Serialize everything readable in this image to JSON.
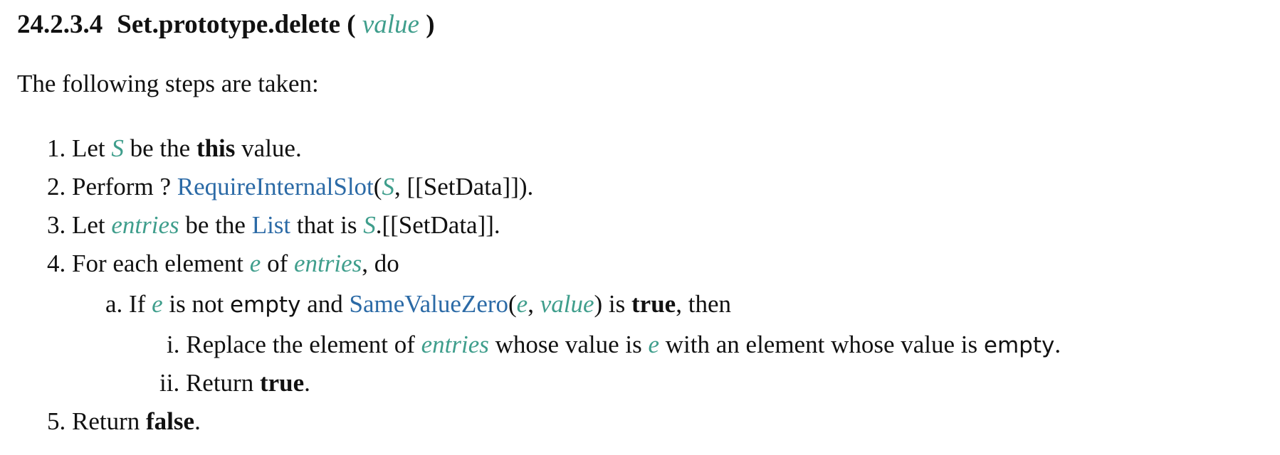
{
  "heading": {
    "number": "24.2.3.4",
    "name": "Set.prototype.delete (",
    "param": "value",
    "close": ")"
  },
  "intro": "The following steps are taken:",
  "steps": {
    "s1": {
      "marker": "1.",
      "t1": "Let",
      "v1": "S",
      "t2": "be the",
      "b1": "this",
      "t3": "value."
    },
    "s2": {
      "marker": "2.",
      "t1": "Perform ?",
      "link1": "RequireInternalSlot",
      "t2": "(",
      "v1": "S",
      "t3": ", [[SetData]])."
    },
    "s3": {
      "marker": "3.",
      "t1": "Let",
      "v1": "entries",
      "t2": "be the",
      "link1": "List",
      "t3": "that is",
      "v2": "S",
      "t4": ".[[SetData]]."
    },
    "s4": {
      "marker": "4.",
      "t1": "For each element",
      "v1": "e",
      "t2": "of",
      "v2": "entries",
      "t3": ", do"
    },
    "s4a": {
      "marker": "a.",
      "t1": "If",
      "v1": "e",
      "t2": "is not",
      "m1": "empty",
      "t3": "and",
      "link1": "SameValueZero",
      "t4": "(",
      "v2": "e",
      "t5": ",",
      "v3": "value",
      "t6": ") is",
      "b1": "true",
      "t7": ", then"
    },
    "s4ai": {
      "marker": "i.",
      "t1": "Replace the element of",
      "v1": "entries",
      "t2": "whose value is",
      "v2": "e",
      "t3": "with an element whose value is",
      "m1": "empty",
      "t4": "."
    },
    "s4aii": {
      "marker": "ii.",
      "t1": "Return",
      "b1": "true",
      "t2": "."
    },
    "s5": {
      "marker": "5.",
      "t1": "Return",
      "b1": "false",
      "t2": "."
    }
  },
  "colors": {
    "variable": "#3f9e8c",
    "link": "#2b6aa6",
    "text": "#111111"
  }
}
